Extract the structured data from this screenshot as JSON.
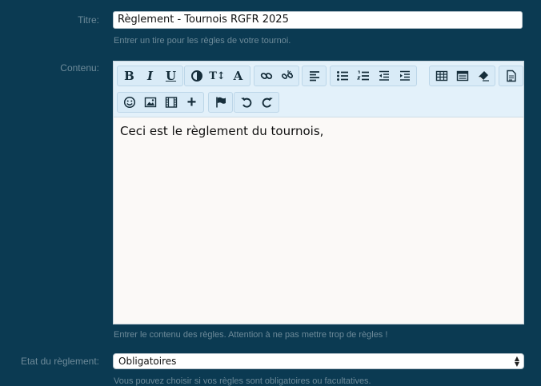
{
  "fields": {
    "title_label": "Titre:",
    "title_value": "Règlement - Tournois RGFR 2025",
    "title_hint": "Entrer un tire pour les règles de votre tournoi.",
    "content_label": "Contenu:",
    "content_text": "Ceci est le règlement du tournois,",
    "content_hint": "Entrer le contenu des règles. Attention à ne pas mettre trop de règles !",
    "status_label": "Etat du règlement:",
    "status_value": "Obligatoires",
    "status_hint": "Vous pouvez choisir si vos règles sont obligatoires ou facultatives."
  },
  "toolbar": {
    "bold": "B",
    "italic": "I",
    "underline": "U",
    "text_size": "T↕",
    "font": "A",
    "add": "+"
  },
  "colors": {
    "background": "#0b3a52",
    "hint_text": "#6d8a99",
    "toolbar_bg": "#e3f1fa",
    "editor_bg": "#fbf9f7"
  }
}
